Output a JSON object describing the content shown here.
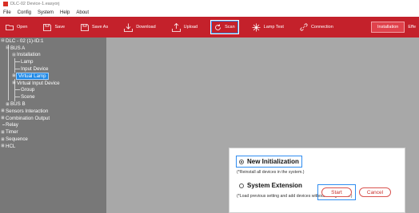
{
  "window": {
    "title": "DLC-02   Device-1.easyorj"
  },
  "menu": [
    "File",
    "Config",
    "System",
    "Help",
    "About"
  ],
  "toolbar": {
    "open": "Open",
    "save": "Save",
    "save_as": "Save As",
    "download": "Download",
    "upload": "Upload",
    "scan": "Scan",
    "lamp_test": "Lamp Test",
    "connection": "Connection",
    "installation": "Installation",
    "effect": "Effe"
  },
  "tree": {
    "root": "DLC - 02 (1)-ID:1",
    "bus_a": "BUS A",
    "installation": "Installation",
    "lamp": "Lamp",
    "input_device": "Input Device",
    "virtual_lamp": "Virtual Lamp",
    "virtual_input_device": "Virtual Input Device",
    "group": "Group",
    "scene": "Scene",
    "bus_b": "BUS B",
    "sensors_interaction": "Sensors Interaction",
    "combination_output": "Combination Output",
    "relay": "Relay",
    "timer": "Timer",
    "sequence": "Sequence",
    "hcl": "HCL"
  },
  "dialog": {
    "new_init": "New Initialization",
    "new_init_desc": "(*Reinstall all devices in the system.)",
    "sys_ext": "System Extension",
    "sys_ext_desc": "(*Load previous setting and add devices without configuration.)",
    "start": "Start",
    "cancel": "Cancel",
    "selected_option": "New Initialization"
  }
}
